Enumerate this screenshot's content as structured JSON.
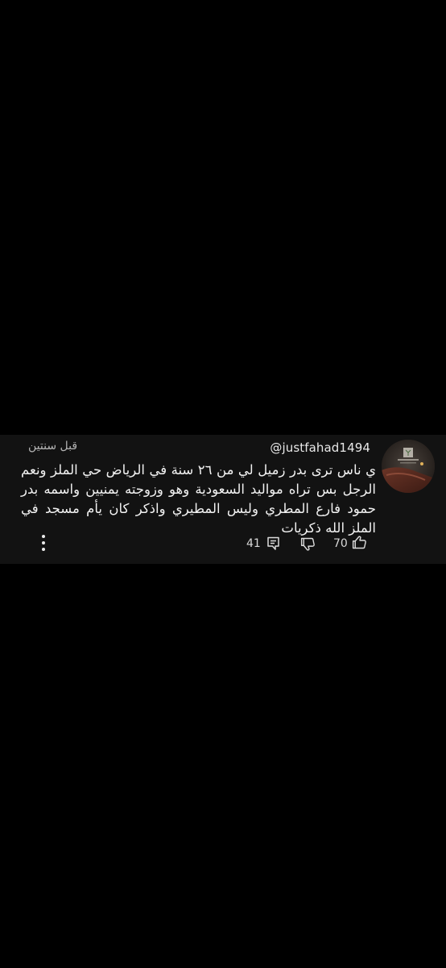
{
  "comment": {
    "username": "@justfahad1494",
    "timestamp": "قبل سنتين",
    "text": "ي ناس ترى بدر زميل لي من ٢٦ سنة في الرياض حي الملز ونعم الرجل بس تراه مواليد السعودية وهو وزوجته يمنيين واسمه بدر حمود فارع المطري وليس المطيري واذكر كان يأم مسجد في الملز الله ذكريات",
    "avatar_icon": "profile-avatar-image",
    "likes": "70",
    "replies": "41",
    "icons": {
      "like": "thumb-up-icon",
      "dislike": "thumb-down-icon",
      "reply": "reply-comment-icon",
      "more": "more-vertical-icon"
    }
  }
}
